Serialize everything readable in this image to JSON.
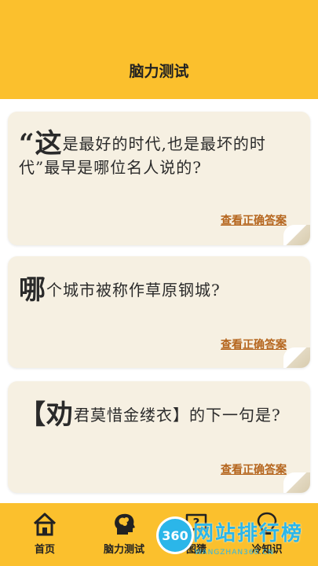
{
  "header": {
    "title": "脑力测试"
  },
  "questions": [
    {
      "lead": "“这",
      "rest": "是最好的时代,也是最坏的时代”最早是哪位名人说的?",
      "link": "查看正确答案"
    },
    {
      "lead": "哪",
      "rest": "个城市被称作草原钢城?",
      "link": "查看正确答案"
    },
    {
      "lead": "【劝",
      "rest": "君莫惜金缕衣】的下一句是?",
      "link": "查看正确答案"
    }
  ],
  "tabbar": {
    "tabs": [
      {
        "label": "首页",
        "icon": "home-icon"
      },
      {
        "label": "脑力测试",
        "icon": "brain-head-icon"
      },
      {
        "label": "图猜",
        "icon": "question-bubble-icon"
      },
      {
        "label": "冷知识",
        "icon": "lightbulb-icon"
      }
    ]
  },
  "watermark": {
    "badge": "360",
    "text": "网站排行榜",
    "sub": "WANGZHAN360.CN"
  },
  "colors": {
    "accent": "#fbc02d",
    "card": "#f6f0e2",
    "link": "#b5651d",
    "watermark": "#2bb6e9"
  }
}
